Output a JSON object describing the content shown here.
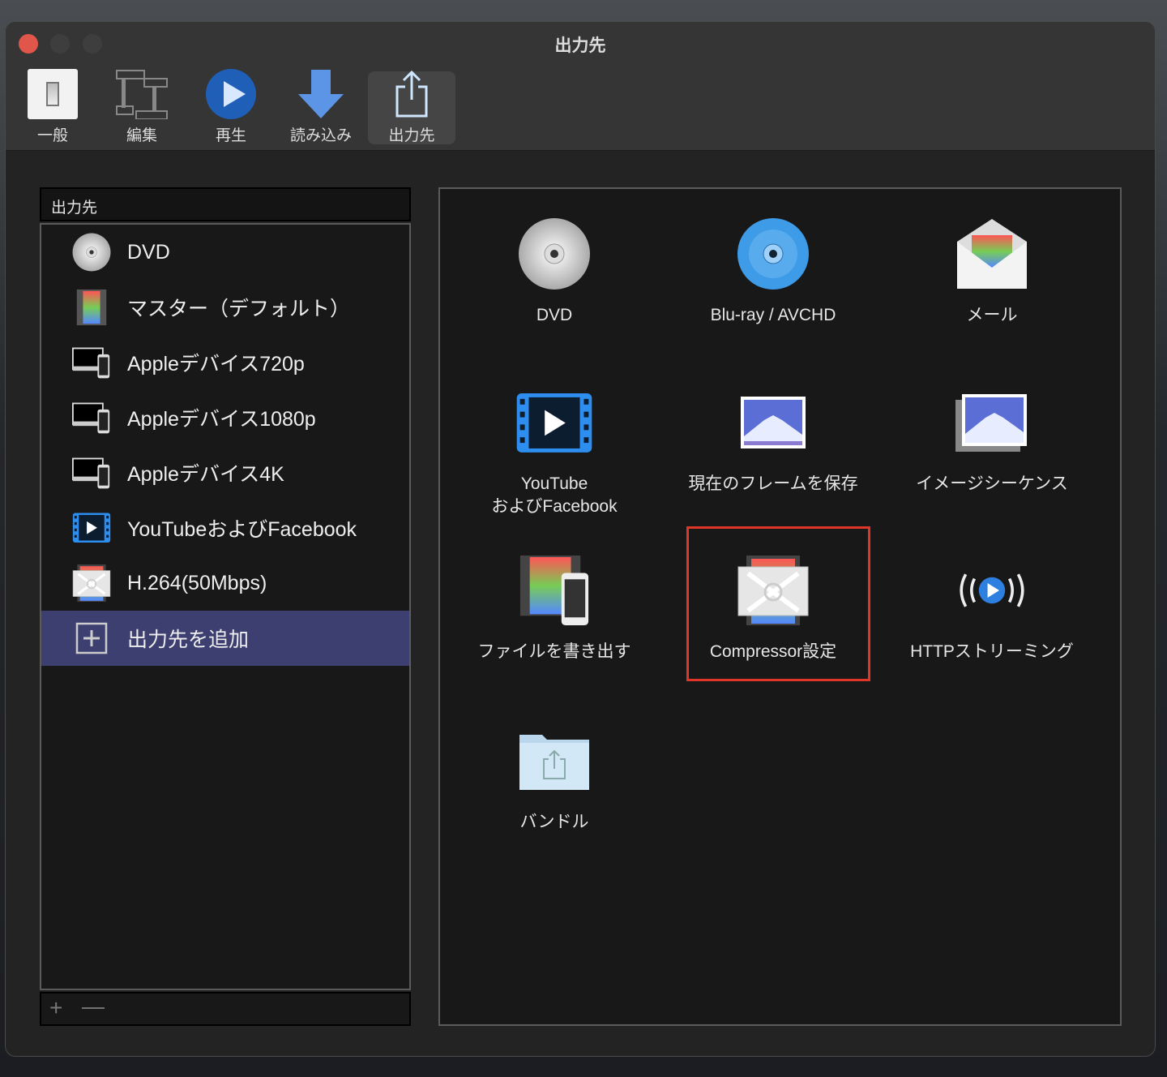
{
  "window": {
    "title": "出力先"
  },
  "toolbar": [
    {
      "label": "一般",
      "icon": "switch-icon"
    },
    {
      "label": "編集",
      "icon": "film-edit-icon"
    },
    {
      "label": "再生",
      "icon": "play-icon"
    },
    {
      "label": "読み込み",
      "icon": "download-arrow-icon"
    },
    {
      "label": "出力先",
      "icon": "share-icon",
      "selected": true
    }
  ],
  "sidebar": {
    "header": "出力先",
    "items": [
      {
        "label": "DVD",
        "icon": "dvd-icon"
      },
      {
        "label": "マスター（デフォルト）",
        "icon": "film-icon"
      },
      {
        "label": "Appleデバイス720p",
        "icon": "devices-icon"
      },
      {
        "label": "Appleデバイス1080p",
        "icon": "devices-icon"
      },
      {
        "label": "Appleデバイス4K",
        "icon": "devices-icon"
      },
      {
        "label": "YouTubeおよびFacebook",
        "icon": "video-icon"
      },
      {
        "label": "H.264(50Mbps)",
        "icon": "compressor-icon"
      },
      {
        "label": "出力先を追加",
        "icon": "add-icon",
        "selected": true
      }
    ],
    "footer": {
      "add": "+",
      "remove": "—"
    }
  },
  "destinations": [
    {
      "label": "DVD",
      "icon": "dvd-icon"
    },
    {
      "label": "Blu-ray / AVCHD",
      "icon": "bluray-icon"
    },
    {
      "label": "メール",
      "icon": "mail-icon"
    },
    {
      "label": "YouTube",
      "label2": "およびFacebook",
      "icon": "video-icon"
    },
    {
      "label": "現在のフレームを保存",
      "icon": "photo-icon"
    },
    {
      "label": "イメージシーケンス",
      "icon": "photo-stack-icon"
    },
    {
      "label": "ファイルを書き出す",
      "icon": "film-phone-icon"
    },
    {
      "label": "Compressor設定",
      "icon": "compressor-icon",
      "highlighted": true
    },
    {
      "label": "HTTPストリーミング",
      "icon": "streaming-icon"
    },
    {
      "label": "バンドル",
      "icon": "folder-share-icon"
    }
  ],
  "colors": {
    "selection": "#3d3f70",
    "highlight": "#e0362a",
    "close": "#e0564a"
  }
}
